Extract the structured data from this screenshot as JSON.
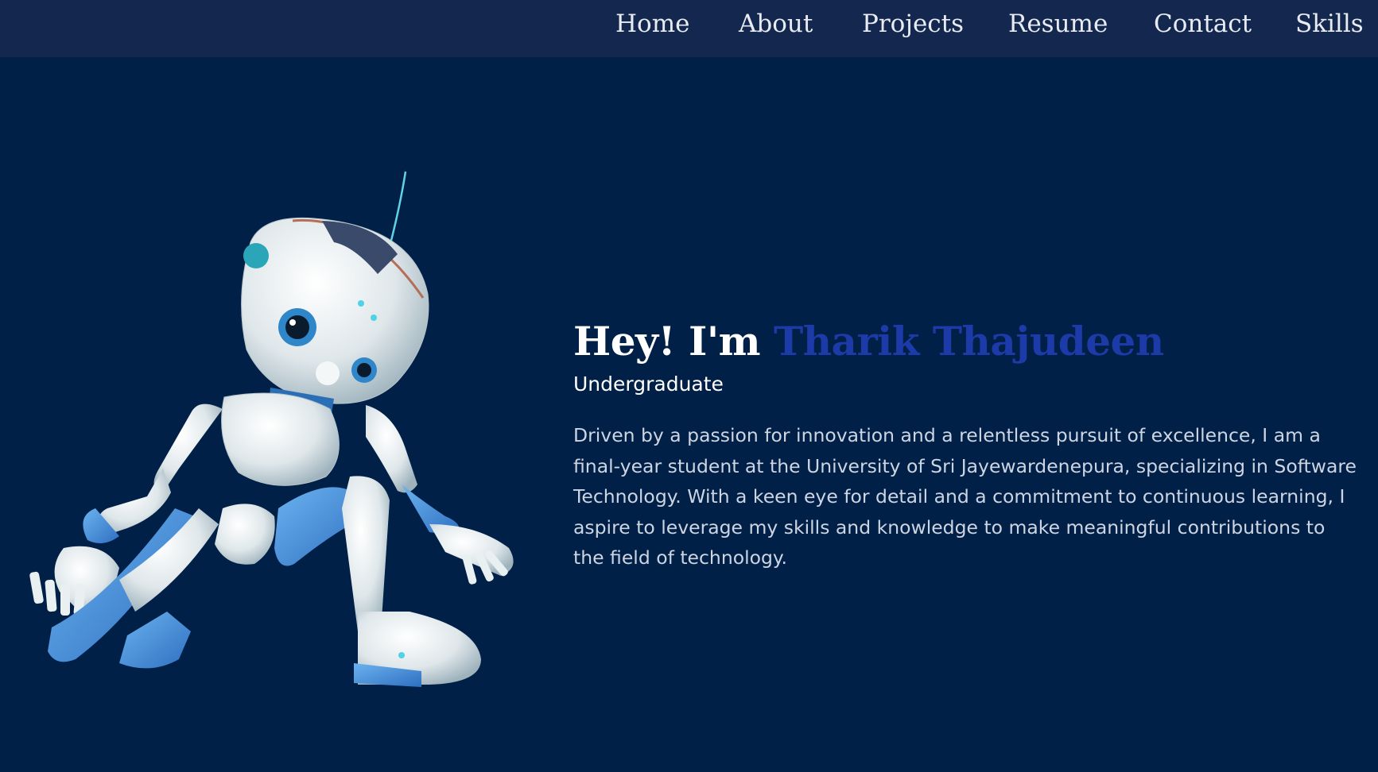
{
  "colors": {
    "page_background": "#012047",
    "navbar_background": "#14274f",
    "accent_name": "#1d3aa9",
    "robot_body": "#e8eef0",
    "robot_accent": "#4f9be6"
  },
  "nav": {
    "items": [
      {
        "label": "Home"
      },
      {
        "label": "About"
      },
      {
        "label": "Projects"
      },
      {
        "label": "Resume"
      },
      {
        "label": "Contact"
      },
      {
        "label": "Skills"
      }
    ]
  },
  "hero": {
    "greeting": "Hey! I'm",
    "name": "Tharik Thajudeen",
    "role": "Undergraduate",
    "bio": "Driven by a passion for innovation and a relentless pursuit of excellence, I am a final-year student at the University of Sri Jayewardenepura, specializing in Software Technology. With a keen eye for detail and a commitment to continuous learning, I aspire to leverage my skills and knowledge to make meaningful contributions to the field of technology."
  },
  "image": {
    "icon": "robot-illustration"
  }
}
